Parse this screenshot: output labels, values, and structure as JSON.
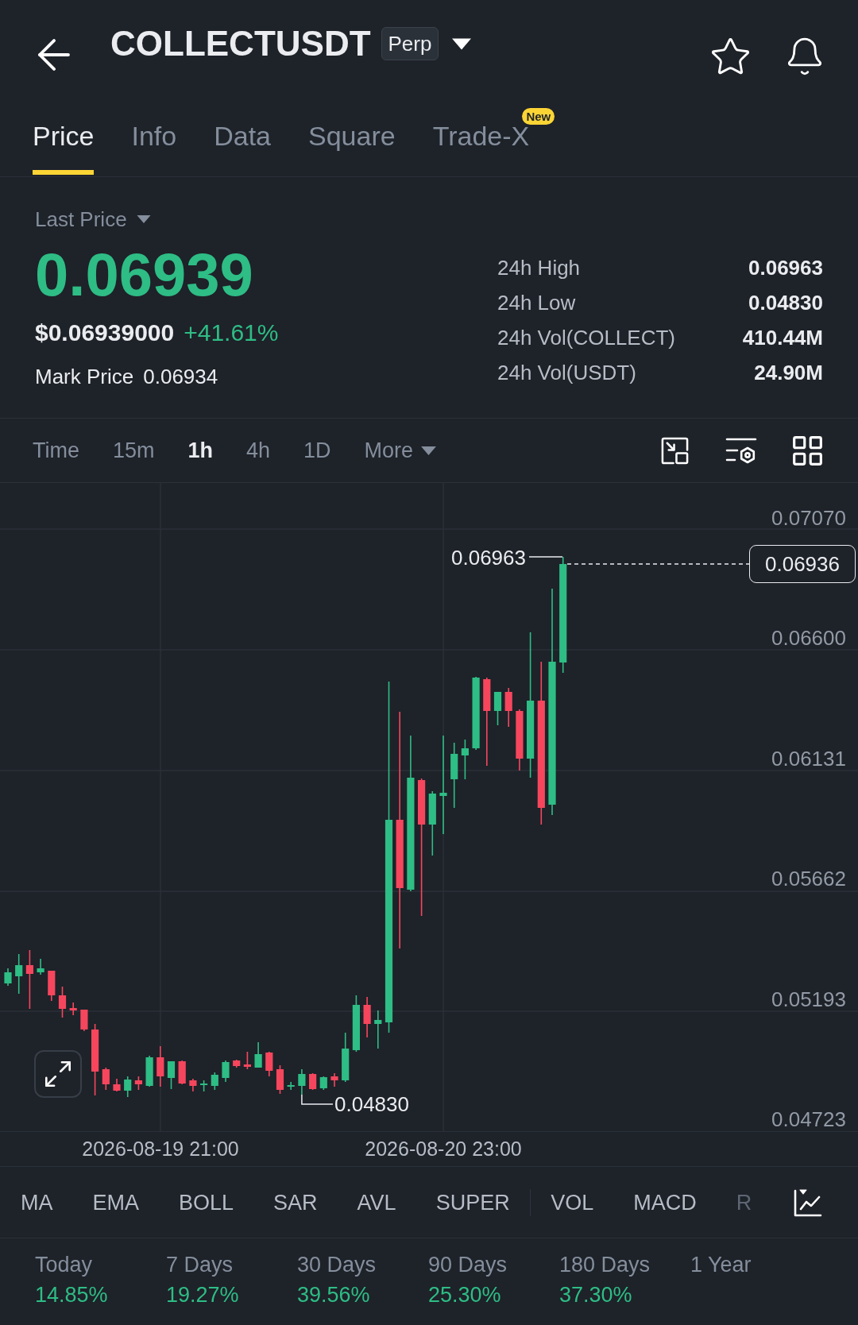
{
  "header": {
    "title": "COLLECTUSDT",
    "badge": "Perp"
  },
  "tabs": [
    {
      "label": "Price",
      "selected": true
    },
    {
      "label": "Info",
      "selected": false
    },
    {
      "label": "Data",
      "selected": false
    },
    {
      "label": "Square",
      "selected": false
    },
    {
      "label": "Trade-X",
      "selected": false,
      "badge": "New"
    }
  ],
  "price": {
    "label": "Last Price",
    "last": "0.06939",
    "usd": "$0.06939000",
    "change": "+41.61%",
    "mark_label": "Mark Price",
    "mark": "0.06934"
  },
  "stats": [
    {
      "label": "24h High",
      "value": "0.06963"
    },
    {
      "label": "24h Low",
      "value": "0.04830"
    },
    {
      "label": "24h Vol(COLLECT)",
      "value": "410.44M"
    },
    {
      "label": "24h Vol(USDT)",
      "value": "24.90M"
    }
  ],
  "intervals": [
    {
      "label": "Time",
      "selected": false,
      "kind": "option"
    },
    {
      "label": "15m",
      "selected": false,
      "kind": "option"
    },
    {
      "label": "1h",
      "selected": true,
      "kind": "option"
    },
    {
      "label": "4h",
      "selected": false,
      "kind": "option"
    },
    {
      "label": "1D",
      "selected": false,
      "kind": "option"
    },
    {
      "label": "More",
      "selected": false,
      "kind": "menu"
    }
  ],
  "chart": {
    "y_axis": [
      "0.07070",
      "0.06600",
      "0.06131",
      "0.05662",
      "0.05193",
      "0.04723"
    ],
    "x_axis": [
      "2026-08-19 21:00",
      "2026-08-20 23:00"
    ],
    "high_label": "0.06963",
    "low_label": "0.04830",
    "last_tag": "0.06936"
  },
  "indicators": {
    "main": [
      {
        "label": "MA",
        "faded": false
      },
      {
        "label": "EMA",
        "faded": false
      },
      {
        "label": "BOLL",
        "faded": false
      },
      {
        "label": "SAR",
        "faded": false
      },
      {
        "label": "AVL",
        "faded": false
      },
      {
        "label": "SUPER",
        "faded": false
      }
    ],
    "sub": [
      {
        "label": "VOL",
        "faded": false
      },
      {
        "label": "MACD",
        "faded": false
      },
      {
        "label": "R",
        "faded": true
      }
    ]
  },
  "performance": [
    {
      "period": "Today",
      "change": "14.85%"
    },
    {
      "period": "7 Days",
      "change": "19.27%"
    },
    {
      "period": "30 Days",
      "change": "39.56%"
    },
    {
      "period": "90 Days",
      "change": "25.30%"
    },
    {
      "period": "180 Days",
      "change": "37.30%"
    },
    {
      "period": "1 Year"
    }
  ]
}
